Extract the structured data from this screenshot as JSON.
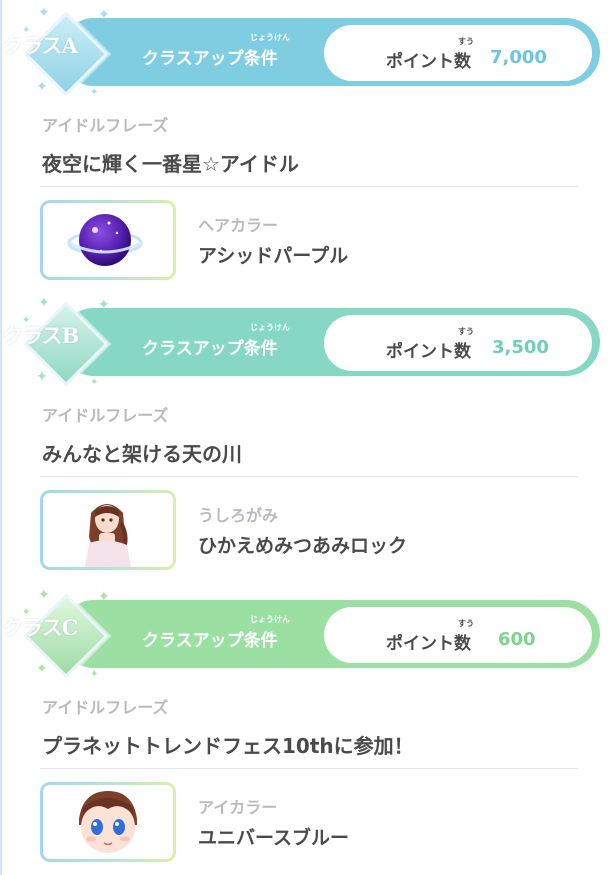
{
  "sections": [
    {
      "class_label": "クラスA",
      "condition_label": "クラスアップ条件",
      "condition_ruby": "じょうけん",
      "points_label": "ポイント数",
      "points_ruby": "すう",
      "points_value": "7,000",
      "phrase_label": "アイドルフレーズ",
      "phrase": "夜空に輝く一番星☆アイドル",
      "item_category": "ヘアカラー",
      "item_name": "アシッドパープル",
      "item_icon": "purple-orb-icon",
      "colors": {
        "banner": "#7fcde0",
        "diamond": "#9dd8e8",
        "points": "#6cc6de",
        "sparkle": "#a8dcee"
      }
    },
    {
      "class_label": "クラスB",
      "condition_label": "クラスアップ条件",
      "condition_ruby": "じょうけん",
      "points_label": "ポイント数",
      "points_ruby": "すう",
      "points_value": "3,500",
      "phrase_label": "アイドルフレーズ",
      "phrase": "みんなと架ける天の川",
      "item_category": "うしろがみ",
      "item_name": "ひかえめみつあみロック",
      "item_icon": "braided-hair-avatar-icon",
      "colors": {
        "banner": "#86d8c4",
        "diamond": "#a5e2cf",
        "points": "#6fcfb7",
        "sparkle": "#a4e0cc"
      }
    },
    {
      "class_label": "クラスC",
      "condition_label": "クラスアップ条件",
      "condition_ruby": "じょうけん",
      "points_label": "ポイント数",
      "points_ruby": "すう",
      "points_value": "600",
      "phrase_label": "アイドルフレーズ",
      "phrase": "プラネットトレンドフェス10thに参加！",
      "item_category": "アイカラー",
      "item_name": "ユニバースブルー",
      "item_icon": "blue-eyes-face-icon",
      "colors": {
        "banner": "#9be0a2",
        "diamond": "#b8eab5",
        "points": "#7fd38f",
        "sparkle": "#a7e3a6"
      }
    }
  ]
}
